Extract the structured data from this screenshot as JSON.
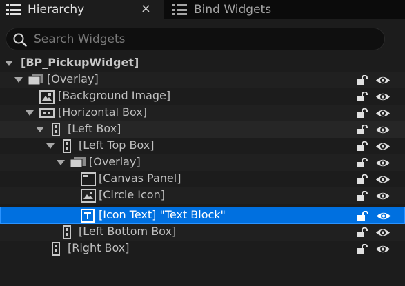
{
  "tabs": {
    "hierarchy": {
      "label": "Hierarchy",
      "icon": "list-icon",
      "close": "×"
    },
    "bind_widgets": {
      "label": "Bind Widgets",
      "icon": "list-icon"
    }
  },
  "search": {
    "placeholder": "Search Widgets",
    "value": ""
  },
  "tree": {
    "root_label": "[BP_PickupWidget]",
    "nodes": [
      {
        "label": "[Overlay]",
        "icon": "overlay-icon",
        "expanded": true
      },
      {
        "label": "[Background Image]",
        "icon": "image-icon"
      },
      {
        "label": "[Horizontal Box]",
        "icon": "horizontal-box-icon",
        "expanded": true
      },
      {
        "label": "[Left Box]",
        "icon": "vertical-box-icon",
        "expanded": true
      },
      {
        "label": "[Left Top Box]",
        "icon": "vertical-box-icon",
        "expanded": true
      },
      {
        "label": "[Overlay]",
        "icon": "overlay-icon",
        "expanded": true
      },
      {
        "label": "[Canvas Panel]",
        "icon": "canvas-panel-icon"
      },
      {
        "label": "[Circle Icon]",
        "icon": "image-icon"
      },
      {
        "label": "[Icon Text] \"Text Block\"",
        "icon": "text-block-icon",
        "selected": true
      },
      {
        "label": "[Left Bottom Box]",
        "icon": "vertical-box-icon"
      },
      {
        "label": "[Right Box]",
        "icon": "vertical-box-icon"
      }
    ]
  },
  "colors": {
    "selection": "#0070e0",
    "panel": "#1c1c1c",
    "tabbar": "#0b0b0b"
  }
}
